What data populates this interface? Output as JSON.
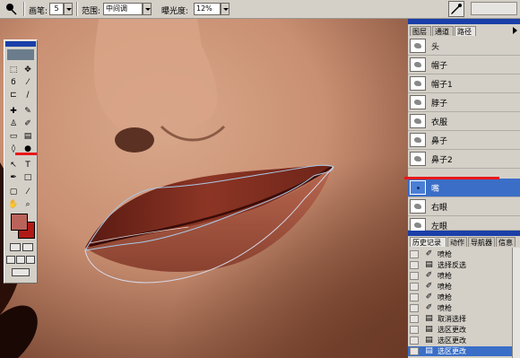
{
  "options_bar": {
    "brush_label": "画笔:",
    "brush_size": "5",
    "range_label": "范围:",
    "range_value": "中间调",
    "exposure_label": "曝光度:",
    "exposure_value": "12%"
  },
  "toolbox": {
    "foreground_color": "#b9635a",
    "background_color": "#b01a16",
    "tools": [
      "marquee-tool",
      "move-tool",
      "lasso-tool",
      "magic-wand-tool",
      "crop-tool",
      "slice-tool",
      "healing-brush-tool",
      "brush-tool",
      "clone-stamp-tool",
      "history-brush-tool",
      "eraser-tool",
      "gradient-tool",
      "blur-tool",
      "dodge-tool",
      "path-select-tool",
      "type-tool",
      "pen-tool",
      "shape-tool",
      "notes-tool",
      "eyedropper-tool",
      "hand-tool",
      "zoom-tool"
    ]
  },
  "paths_panel": {
    "tabs": [
      "图层",
      "通道",
      "路径"
    ],
    "active_tab": "路径",
    "items": [
      {
        "name": "头",
        "selected": false
      },
      {
        "name": "帽子",
        "selected": false
      },
      {
        "name": "帽子1",
        "selected": false
      },
      {
        "name": "脖子",
        "selected": false
      },
      {
        "name": "衣服",
        "selected": false
      },
      {
        "name": "鼻子",
        "selected": false
      },
      {
        "name": "鼻子2",
        "selected": false
      },
      {
        "name": "嘴",
        "selected": true
      },
      {
        "name": "右眼",
        "selected": false
      },
      {
        "name": "左眼",
        "selected": false
      }
    ]
  },
  "history_panel": {
    "tabs": [
      "历史记录",
      "动作",
      "导航器",
      "信息"
    ],
    "active_tab": "历史记录",
    "items": [
      {
        "name": "喷枪",
        "icon": "airbrush-icon",
        "selected": false
      },
      {
        "name": "选择反选",
        "icon": "document-icon",
        "selected": false
      },
      {
        "name": "喷枪",
        "icon": "airbrush-icon",
        "selected": false
      },
      {
        "name": "喷枪",
        "icon": "airbrush-icon",
        "selected": false
      },
      {
        "name": "喷枪",
        "icon": "airbrush-icon",
        "selected": false
      },
      {
        "name": "喷枪",
        "icon": "airbrush-icon",
        "selected": false
      },
      {
        "name": "取消选择",
        "icon": "document-icon",
        "selected": false
      },
      {
        "name": "选区更改",
        "icon": "document-icon",
        "selected": false
      },
      {
        "name": "选区更改",
        "icon": "document-icon",
        "selected": false
      },
      {
        "name": "选区更改",
        "icon": "document-icon",
        "selected": true
      }
    ]
  },
  "colors": {
    "highlight": "#3a6ec7",
    "title_bar": "#1a3fa8",
    "annotation_red": "#e8171b"
  }
}
